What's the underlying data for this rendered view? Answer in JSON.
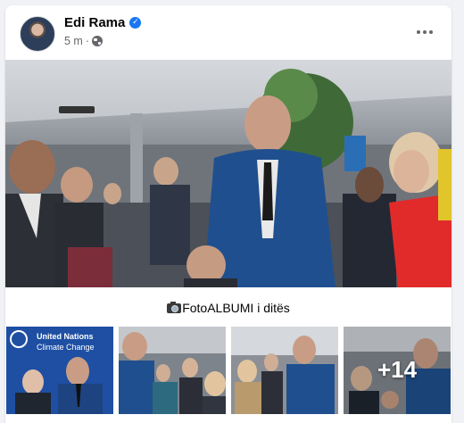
{
  "post": {
    "author": "Edi Rama",
    "timestamp": "5 m",
    "separator": "·",
    "caption": "FotoALBUMI i ditës"
  },
  "thumbnails": [
    {
      "label_line1": "United Nations",
      "label_line2": "Climate Change"
    },
    {},
    {},
    {
      "more_count": "+14"
    }
  ],
  "colors": {
    "verified_blue": "#1877f2",
    "meta_gray": "#65676b",
    "un_blue": "#1e4fa3"
  },
  "icons": {
    "verified": "check-badge-icon",
    "audience": "globe-icon",
    "menu": "more-dots-icon",
    "caption_prefix": "camera-icon"
  }
}
